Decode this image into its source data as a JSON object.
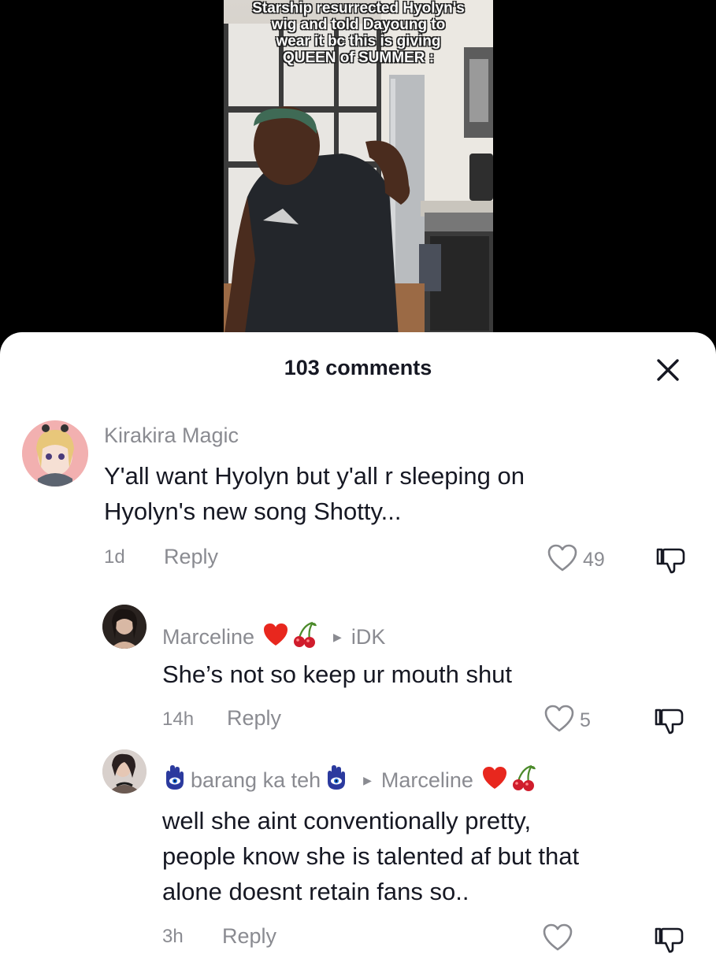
{
  "video": {
    "caption": "Starship resurrected Hyolyn's\nwig and told Dayoung to\nwear it bc this is giving\nQUEEN of SUMMER :"
  },
  "sheet": {
    "title": "103 comments"
  },
  "comments": [
    {
      "username": "Kirakira Magic",
      "text": "Y'all want Hyolyn but y'all r sleeping on\nHyolyn's new song Shotty...",
      "time": "1d",
      "reply_label": "Reply",
      "likes": "49"
    },
    {
      "username": "Marceline",
      "reply_to": "iDK",
      "text": "She’s not so keep ur mouth shut",
      "time": "14h",
      "reply_label": "Reply",
      "likes": "5"
    },
    {
      "username": "barang ka teh",
      "reply_to": "Marceline",
      "text": "well she aint conventionally pretty,\npeople know she is talented af but that\nalone doesnt retain fans so..",
      "time": "3h",
      "reply_label": "Reply",
      "likes": ""
    }
  ],
  "icons": {
    "close": "close-icon",
    "like": "heart-outline-icon",
    "dislike": "thumbs-down-icon",
    "heart_emoji": "red-heart-emoji",
    "cherry_emoji": "cherries-emoji",
    "hamsa_emoji": "hamsa-emoji"
  },
  "colors": {
    "text_primary": "#161823",
    "text_secondary": "#8a8b91",
    "sheet_bg": "#ffffff",
    "video_bg": "#000000"
  }
}
